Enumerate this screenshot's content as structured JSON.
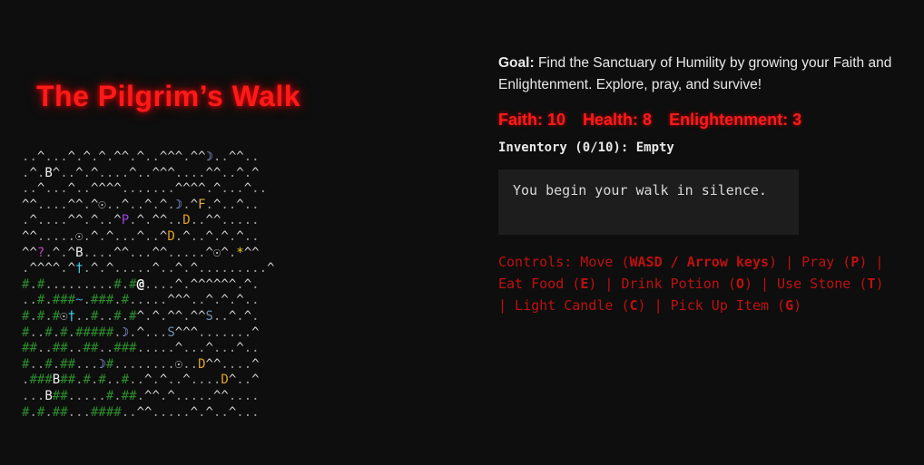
{
  "game": {
    "title": "The Pilgrim’s Walk"
  },
  "map": {
    "rows": [
      "..^...^.^.^.^^.^..^^^.^^☽..^^..",
      ".^.B^..^.^....^..^^^....^^..^.^",
      "..^...^..^^^^.......^^^^.^...^..",
      "^^....^^.^☉..^..^.^.☽.^F.^..^..",
      ".^....^^.^..^P.^.^^..D..^^.....",
      "^^.....☉.^.^...^..^D.^..^.^.^..",
      "^^?.^.^B....^^...^^.....^☉^.*^^",
      ".^^^^.^†.^.^.....^..^.^.........^",
      "#.#.........#.#@....^.^^^^^^.^.",
      "..#.###~.###.#.....^^^..^.^.^..",
      "#.#.#☉†..#..#.#^.^.^^.^^S..^.^.",
      "#..#.#.#####.☽.^...S^^^.......^",
      "##..##..##..###.....^...^...^..",
      "#..#.##...☽#........☉..D^^....^",
      ".###B##.#.#..#..^.^..^....D^..^",
      "...B##.....#.##.^^.^.....^^....",
      "#.#.##...####..^^.....^.^..^..."
    ]
  },
  "goal": {
    "label": "Goal:",
    "text": "Find the Sanctuary of Humility by growing your Faith and Enlightenment. Explore, pray, and survive!"
  },
  "stats": {
    "faith": "Faith: 10",
    "health": "Health: 8",
    "enlightenment": "Enlightenment: 3"
  },
  "inventory": {
    "text": "Inventory (0/10): Empty"
  },
  "log": {
    "message": "You begin your walk in silence."
  },
  "controls": {
    "prefix": "Controls: Move (",
    "move_keys": "WASD / Arrow keys",
    "pray": ") | Pray (",
    "pray_key": "P",
    "eat": ") | Eat Food (",
    "eat_key": "E",
    "drink": ") | Drink Potion (",
    "drink_key": "O",
    "stone": ") | Use Stone (",
    "stone_key": "T",
    "candle": ") | Light Candle (",
    "candle_key": "C",
    "pickup": ") | Pick Up Item (",
    "pickup_key": "G",
    "suffix": ")"
  },
  "colors": {
    "accent": "#ff1a1a",
    "background": "#0e0e0e",
    "controls": "#c01010",
    "log_bg": "#1d1d1d"
  }
}
